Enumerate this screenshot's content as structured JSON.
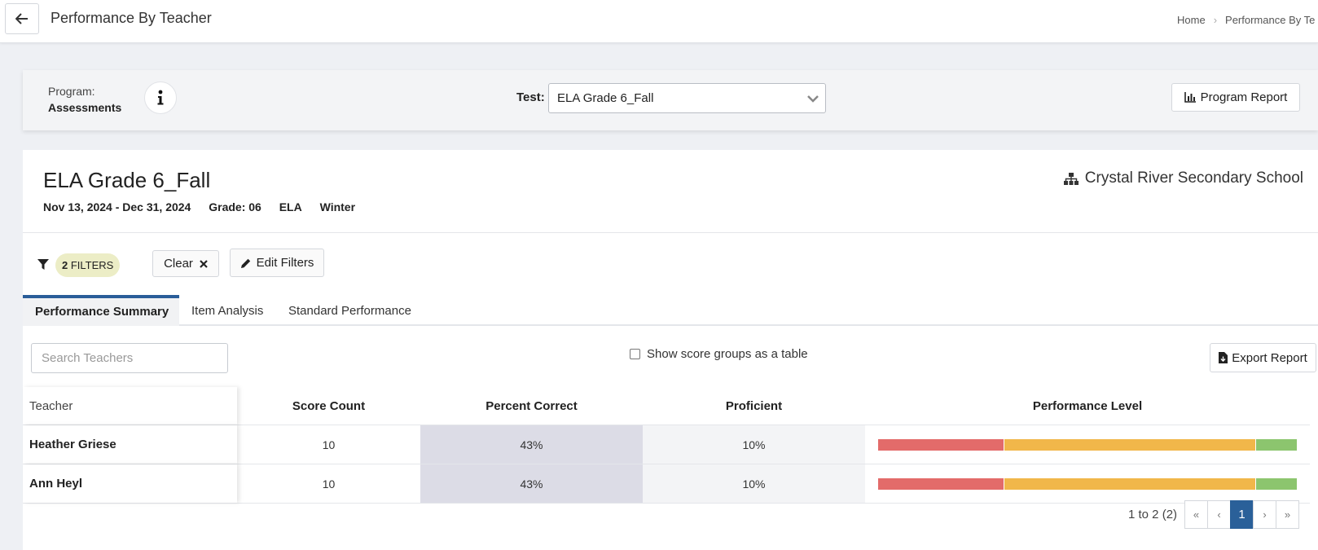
{
  "header": {
    "title": "Performance By Teacher",
    "breadcrumb": [
      "Home",
      "Performance By Te"
    ]
  },
  "program_bar": {
    "program_label": "Program:",
    "program_value": "Assessments",
    "test_label": "Test:",
    "test_value": "ELA Grade 6_Fall",
    "program_report_label": "Program Report"
  },
  "test_info": {
    "title": "ELA Grade 6_Fall",
    "date_range": "Nov 13, 2024 - Dec 31, 2024",
    "grade": "Grade: 06",
    "subject": "ELA",
    "season": "Winter",
    "school": "Crystal River Secondary School"
  },
  "filters": {
    "count": "2",
    "label": "FILTERS",
    "clear_label": "Clear",
    "edit_label": "Edit Filters"
  },
  "tabs": [
    {
      "label": "Performance Summary",
      "active": true
    },
    {
      "label": "Item Analysis",
      "active": false
    },
    {
      "label": "Standard Performance",
      "active": false
    }
  ],
  "toolbar": {
    "search_placeholder": "Search Teachers",
    "show_groups_label": "Show score groups as a table",
    "export_label": "Export Report"
  },
  "table": {
    "columns": [
      "Teacher",
      "Score Count",
      "Percent Correct",
      "Proficient",
      "Performance Level"
    ],
    "rows": [
      {
        "teacher": "Heather Griese",
        "score_count": "10",
        "percent_correct": "43%",
        "proficient": "10%",
        "levels": [
          30,
          60,
          10
        ]
      },
      {
        "teacher": "Ann Heyl",
        "score_count": "10",
        "percent_correct": "43%",
        "proficient": "10%",
        "levels": [
          30,
          60,
          10
        ]
      }
    ],
    "level_colors": [
      "#e36b6a",
      "#f1b74a",
      "#8cc56e"
    ]
  },
  "pagination": {
    "info": "1 to 2 (2)",
    "first": "«",
    "prev": "‹",
    "current": "1",
    "next": "›",
    "last": "»"
  }
}
